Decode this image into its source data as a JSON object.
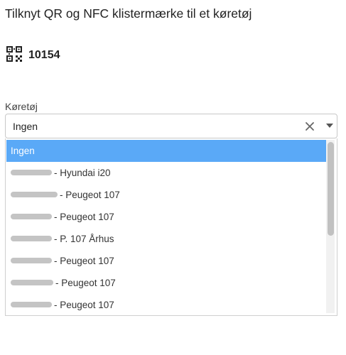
{
  "title": "Tilknyt QR og NFC klistermærke til et køretøj",
  "qr": {
    "icon": "qr-code-icon",
    "id": "10154"
  },
  "field": {
    "label": "Køretøj",
    "value": "Ingen",
    "clear_icon": "close-icon",
    "caret_icon": "caret-down-icon"
  },
  "dropdown": {
    "options": [
      {
        "label": "Ingen",
        "selected": true
      },
      {
        "label": "- Hyundai i20",
        "redacted": true
      },
      {
        "label": "- Peugeot 107",
        "redacted": true
      },
      {
        "label": "- Peugeot 107",
        "redacted": true
      },
      {
        "label": "- P. 107 Århus",
        "redacted": true
      },
      {
        "label": "- Peugeot 107",
        "redacted": true
      },
      {
        "label": "- Peugeot 107",
        "redacted": true
      },
      {
        "label": "- Peugeot 107",
        "redacted": true
      }
    ],
    "selected_color": "#5aa9f7"
  }
}
